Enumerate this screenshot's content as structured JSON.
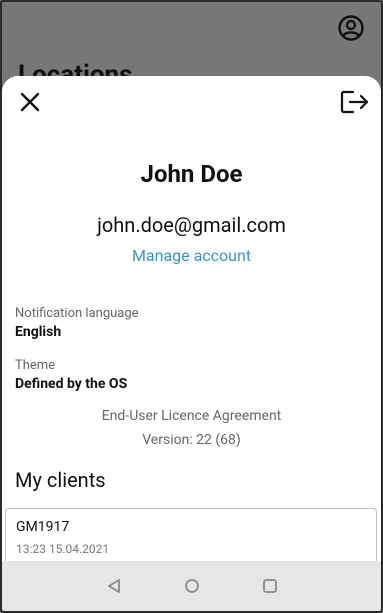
{
  "background": {
    "title": "Locations",
    "avatar_icon": "account-circle-icon"
  },
  "sheet": {
    "close_icon": "close-icon",
    "logout_icon": "logout-icon",
    "user_name": "John Doe",
    "user_email": "john.doe@gmail.com",
    "manage_account_label": "Manage account",
    "settings": [
      {
        "label": "Notification language",
        "value": "English"
      },
      {
        "label": "Theme",
        "value": "Defined by the OS"
      }
    ],
    "eula_label": "End-User Licence Agreement",
    "version_text": "Version: 22 (68)",
    "clients_title": "My clients",
    "clients": [
      {
        "name": "GM1917",
        "timestamp": "13:23 15.04.2021"
      }
    ]
  },
  "navbar": {
    "icons": [
      "back-icon",
      "home-icon",
      "recents-icon"
    ]
  },
  "colors": {
    "link": "#3a93c9",
    "scrim": "#777777",
    "navbar": "#e6e6e6"
  }
}
